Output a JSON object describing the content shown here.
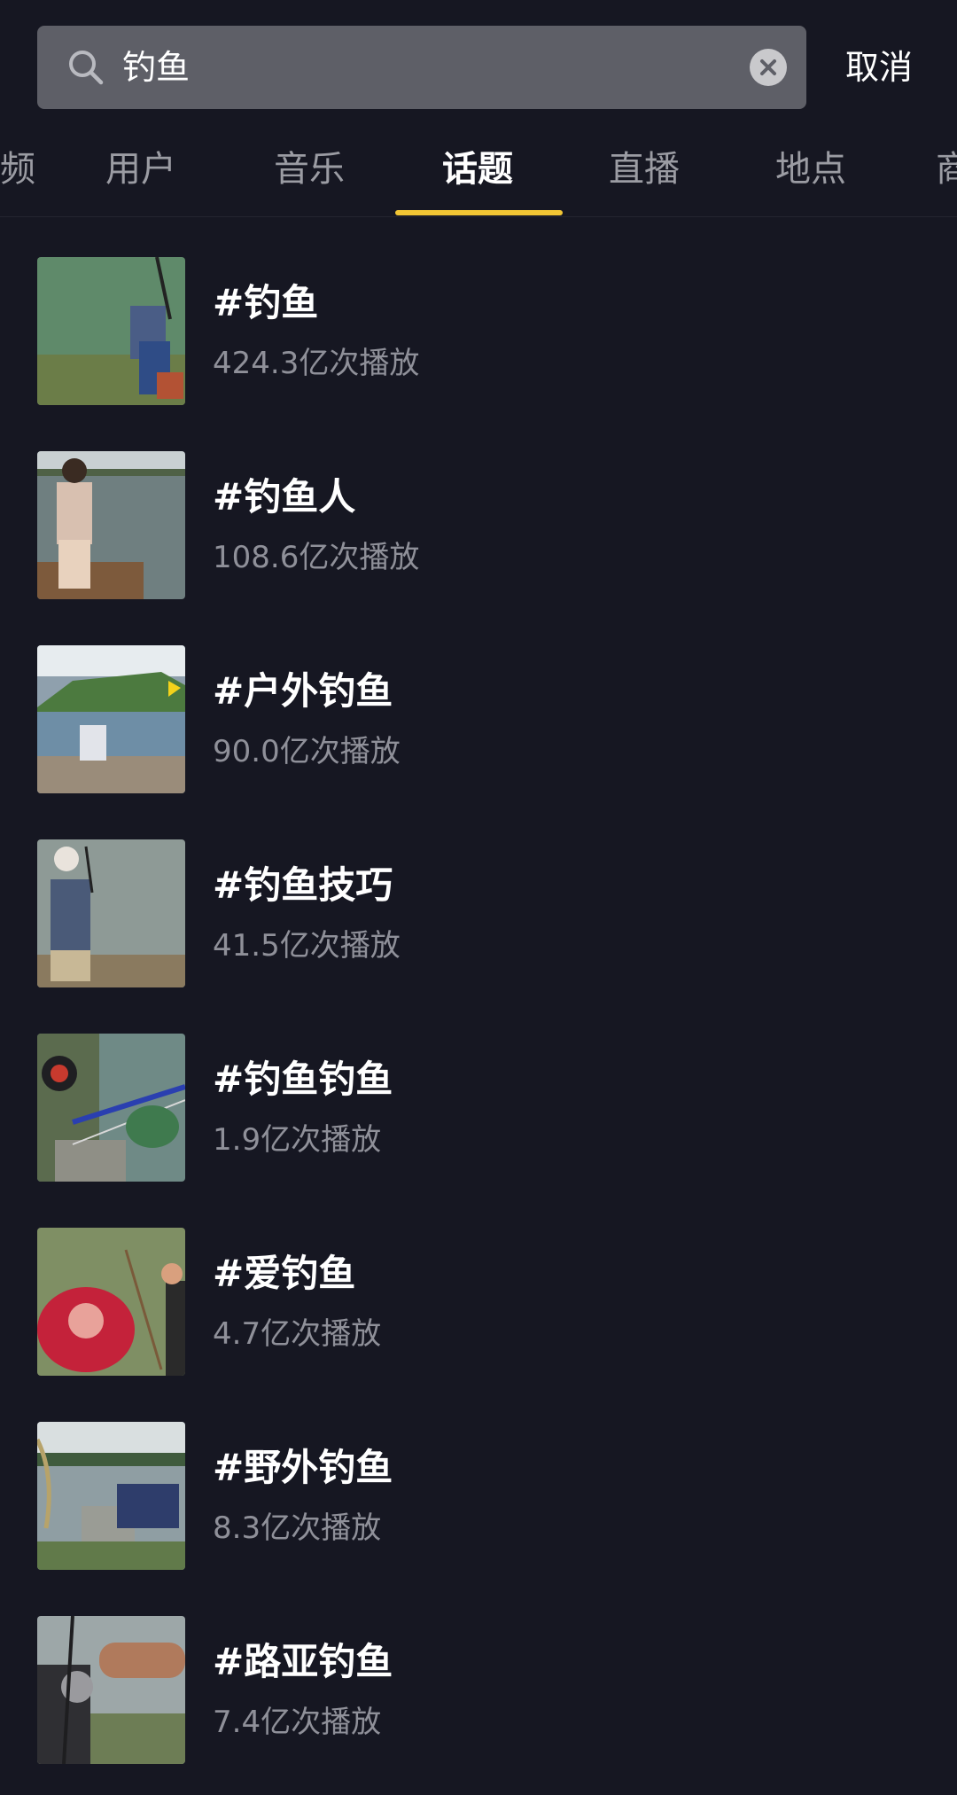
{
  "search": {
    "query": "钓鱼",
    "cancel_label": "取消"
  },
  "tabs": {
    "partial_left": "频",
    "items": [
      {
        "label": "用户"
      },
      {
        "label": "音乐"
      },
      {
        "label": "话题",
        "active": true
      },
      {
        "label": "直播"
      },
      {
        "label": "地点"
      }
    ],
    "partial_right": "商"
  },
  "topics": [
    {
      "title": "#钓鱼",
      "views": "424.3亿次播放"
    },
    {
      "title": "#钓鱼人",
      "views": "108.6亿次播放"
    },
    {
      "title": "#户外钓鱼",
      "views": "90.0亿次播放"
    },
    {
      "title": "#钓鱼技巧",
      "views": "41.5亿次播放"
    },
    {
      "title": "#钓鱼钓鱼",
      "views": "1.9亿次播放"
    },
    {
      "title": "#爱钓鱼",
      "views": "4.7亿次播放"
    },
    {
      "title": "#野外钓鱼",
      "views": "8.3亿次播放"
    },
    {
      "title": "#路亚钓鱼",
      "views": "7.4亿次播放"
    }
  ],
  "colors": {
    "background": "#161722",
    "search_field": "#5e5f67",
    "accent_tab_indicator": "#f2c634",
    "secondary_text": "#8f9099"
  },
  "icons": {
    "search": "search-icon",
    "clear": "clear-search-icon"
  }
}
